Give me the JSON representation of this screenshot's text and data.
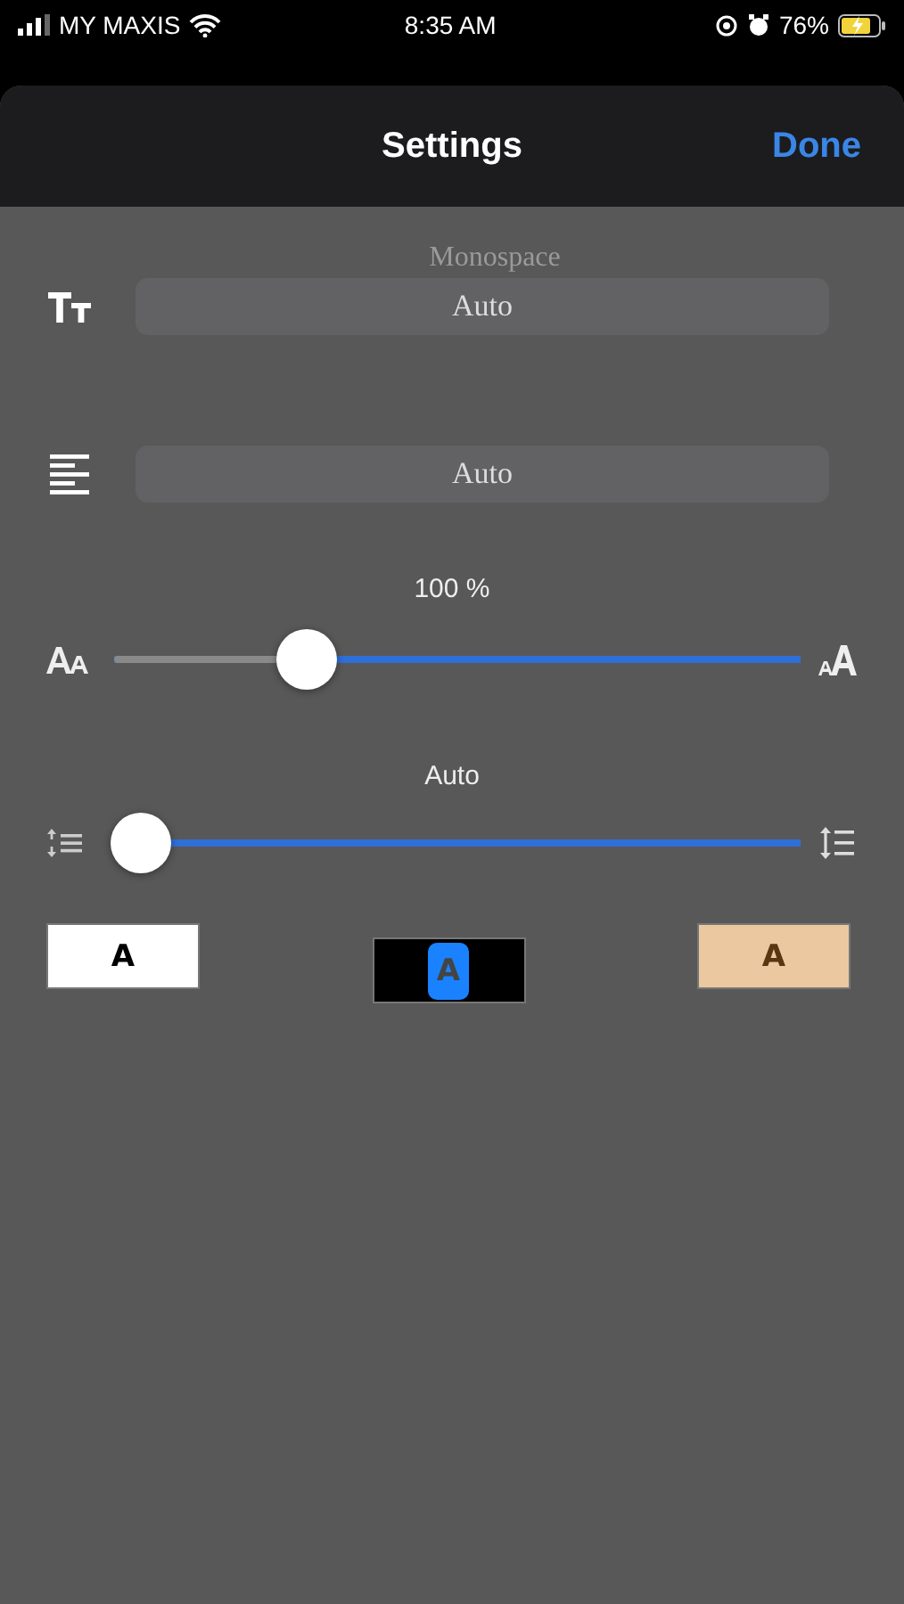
{
  "status_bar": {
    "carrier": "MY MAXIS",
    "time": "8:35 AM",
    "battery": "76%"
  },
  "sheet": {
    "title": "Settings",
    "done": "Done"
  },
  "font_picker": {
    "above": "Monospace",
    "value": "Auto"
  },
  "alignment_picker": {
    "value": "Auto"
  },
  "font_size": {
    "reading": "100 %",
    "level": 0.28
  },
  "line_spacing": {
    "reading": "Auto",
    "level": 0.04
  },
  "themes": [
    {
      "label": "A",
      "kind": "light",
      "selected": false
    },
    {
      "label": "A",
      "kind": "dark",
      "selected": true
    },
    {
      "label": "A",
      "kind": "sepia",
      "selected": false
    }
  ]
}
